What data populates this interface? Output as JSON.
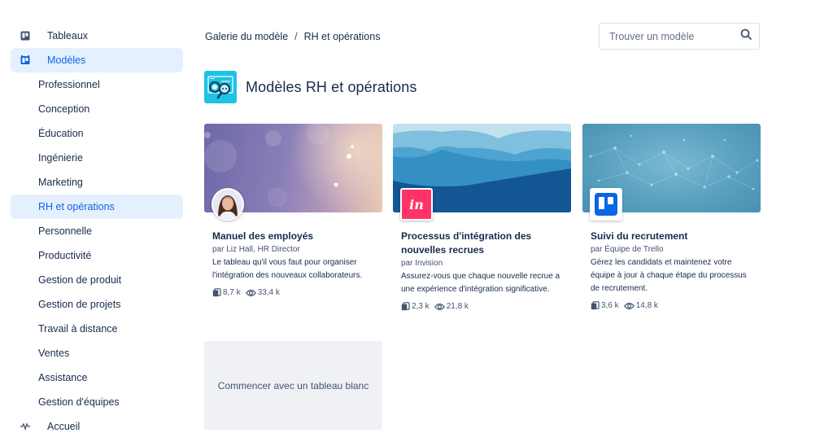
{
  "sidebar": {
    "top_items": [
      {
        "label": "Tableaux",
        "icon": "board-icon"
      },
      {
        "label": "Modèles",
        "icon": "template-icon",
        "active": true
      }
    ],
    "sub_items": [
      {
        "label": "Professionnel"
      },
      {
        "label": "Conception"
      },
      {
        "label": "Éducation"
      },
      {
        "label": "Ingénierie"
      },
      {
        "label": "Marketing"
      },
      {
        "label": "RH et opérations",
        "active": true
      },
      {
        "label": "Personnelle"
      },
      {
        "label": "Productivité"
      },
      {
        "label": "Gestion de produit"
      },
      {
        "label": "Gestion de projets"
      },
      {
        "label": "Travail à distance"
      },
      {
        "label": "Ventes"
      },
      {
        "label": "Assistance"
      },
      {
        "label": "Gestion d'équipes"
      }
    ],
    "bottom_item": {
      "label": "Accueil",
      "icon": "activity-icon"
    }
  },
  "header": {
    "breadcrumb": [
      {
        "label": "Galerie du modèle"
      },
      {
        "label": "RH et opérations"
      }
    ],
    "breadcrumb_separator": "/",
    "search": {
      "placeholder": "Trouver un modèle",
      "value": ""
    }
  },
  "page": {
    "title": "Modèles RH et opérations",
    "icon": "hr-operations-icon",
    "icon_color": "#1ec2e5"
  },
  "cards": [
    {
      "title": "Manuel des employés",
      "author": "par Liz Hall, HR Director",
      "description": "Le tableau qu'il vous faut pour organiser l'intégration des nouveaux collaborateurs.",
      "copies": "8,7 k",
      "views": "33,4 k",
      "badge": "author-avatar"
    },
    {
      "title": "Processus d'intégration des nouvelles recrues",
      "author": "par Invision",
      "description": "Assurez-vous que chaque nouvelle recrue a une expérience d'intégration significative.",
      "copies": "2,3 k",
      "views": "21,8 k",
      "badge": "invision-logo",
      "badge_text": "in",
      "badge_color": "#ff3366"
    },
    {
      "title": "Suivi du recrutement",
      "author": "par Équipe de Trello",
      "description": "Gérez les candidats et maintenez votre équipe à jour à chaque étape du processus de recrutement.",
      "copies": "3,6 k",
      "views": "14,8 k",
      "badge": "trello-logo",
      "badge_color": "#0c66e4"
    }
  ],
  "blank_board": {
    "label": "Commencer avec un tableau blanc"
  },
  "colors": {
    "accent": "#0c66e4",
    "active_bg": "#e4f0fd",
    "text": "#172b4d",
    "subtle_text": "#44546f"
  }
}
